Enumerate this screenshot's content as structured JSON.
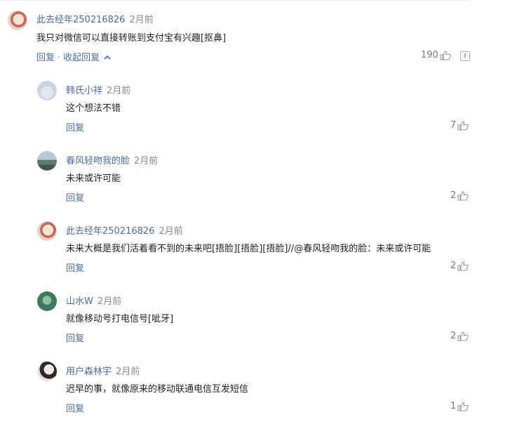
{
  "top_comment": {
    "username": "此去经年250216826",
    "time": "2月前",
    "text": "我只对微信可以直接转账到支付宝有兴趣[抠鼻]",
    "reply_label": "回复",
    "collapse_label": "收起回复",
    "collapse_icon": "chevron-up-icon",
    "likes": "190",
    "report_icon": "report-icon"
  },
  "replies": [
    {
      "username": "韩氏小祥",
      "time": "2月前",
      "text": "这个想法不错",
      "reply_label": "回复",
      "likes": "7"
    },
    {
      "username": "春风轻吻我的脸",
      "time": "2月前",
      "text": "未来或许可能",
      "reply_label": "回复",
      "likes": "2"
    },
    {
      "username": "此去经年250216826",
      "time": "2月前",
      "text": "未来大概是我们活着看不到的未来吧[捂脸][捂脸][捂脸]//@春风轻吻我的脸：未来或许可能",
      "reply_label": "回复",
      "likes": "2"
    },
    {
      "username": "山水W",
      "time": "2月前",
      "text": "就像移动号打电信号[呲牙]",
      "reply_label": "回复",
      "likes": "2"
    },
    {
      "username": "用户森林宇",
      "time": "2月前",
      "text": "迟早的事，就像原来的移动联通电信互发短信",
      "reply_label": "回复",
      "likes": "1"
    }
  ],
  "colors": {
    "username": "#4a6aa8",
    "text": "#222222",
    "muted": "#8a8a8a"
  }
}
